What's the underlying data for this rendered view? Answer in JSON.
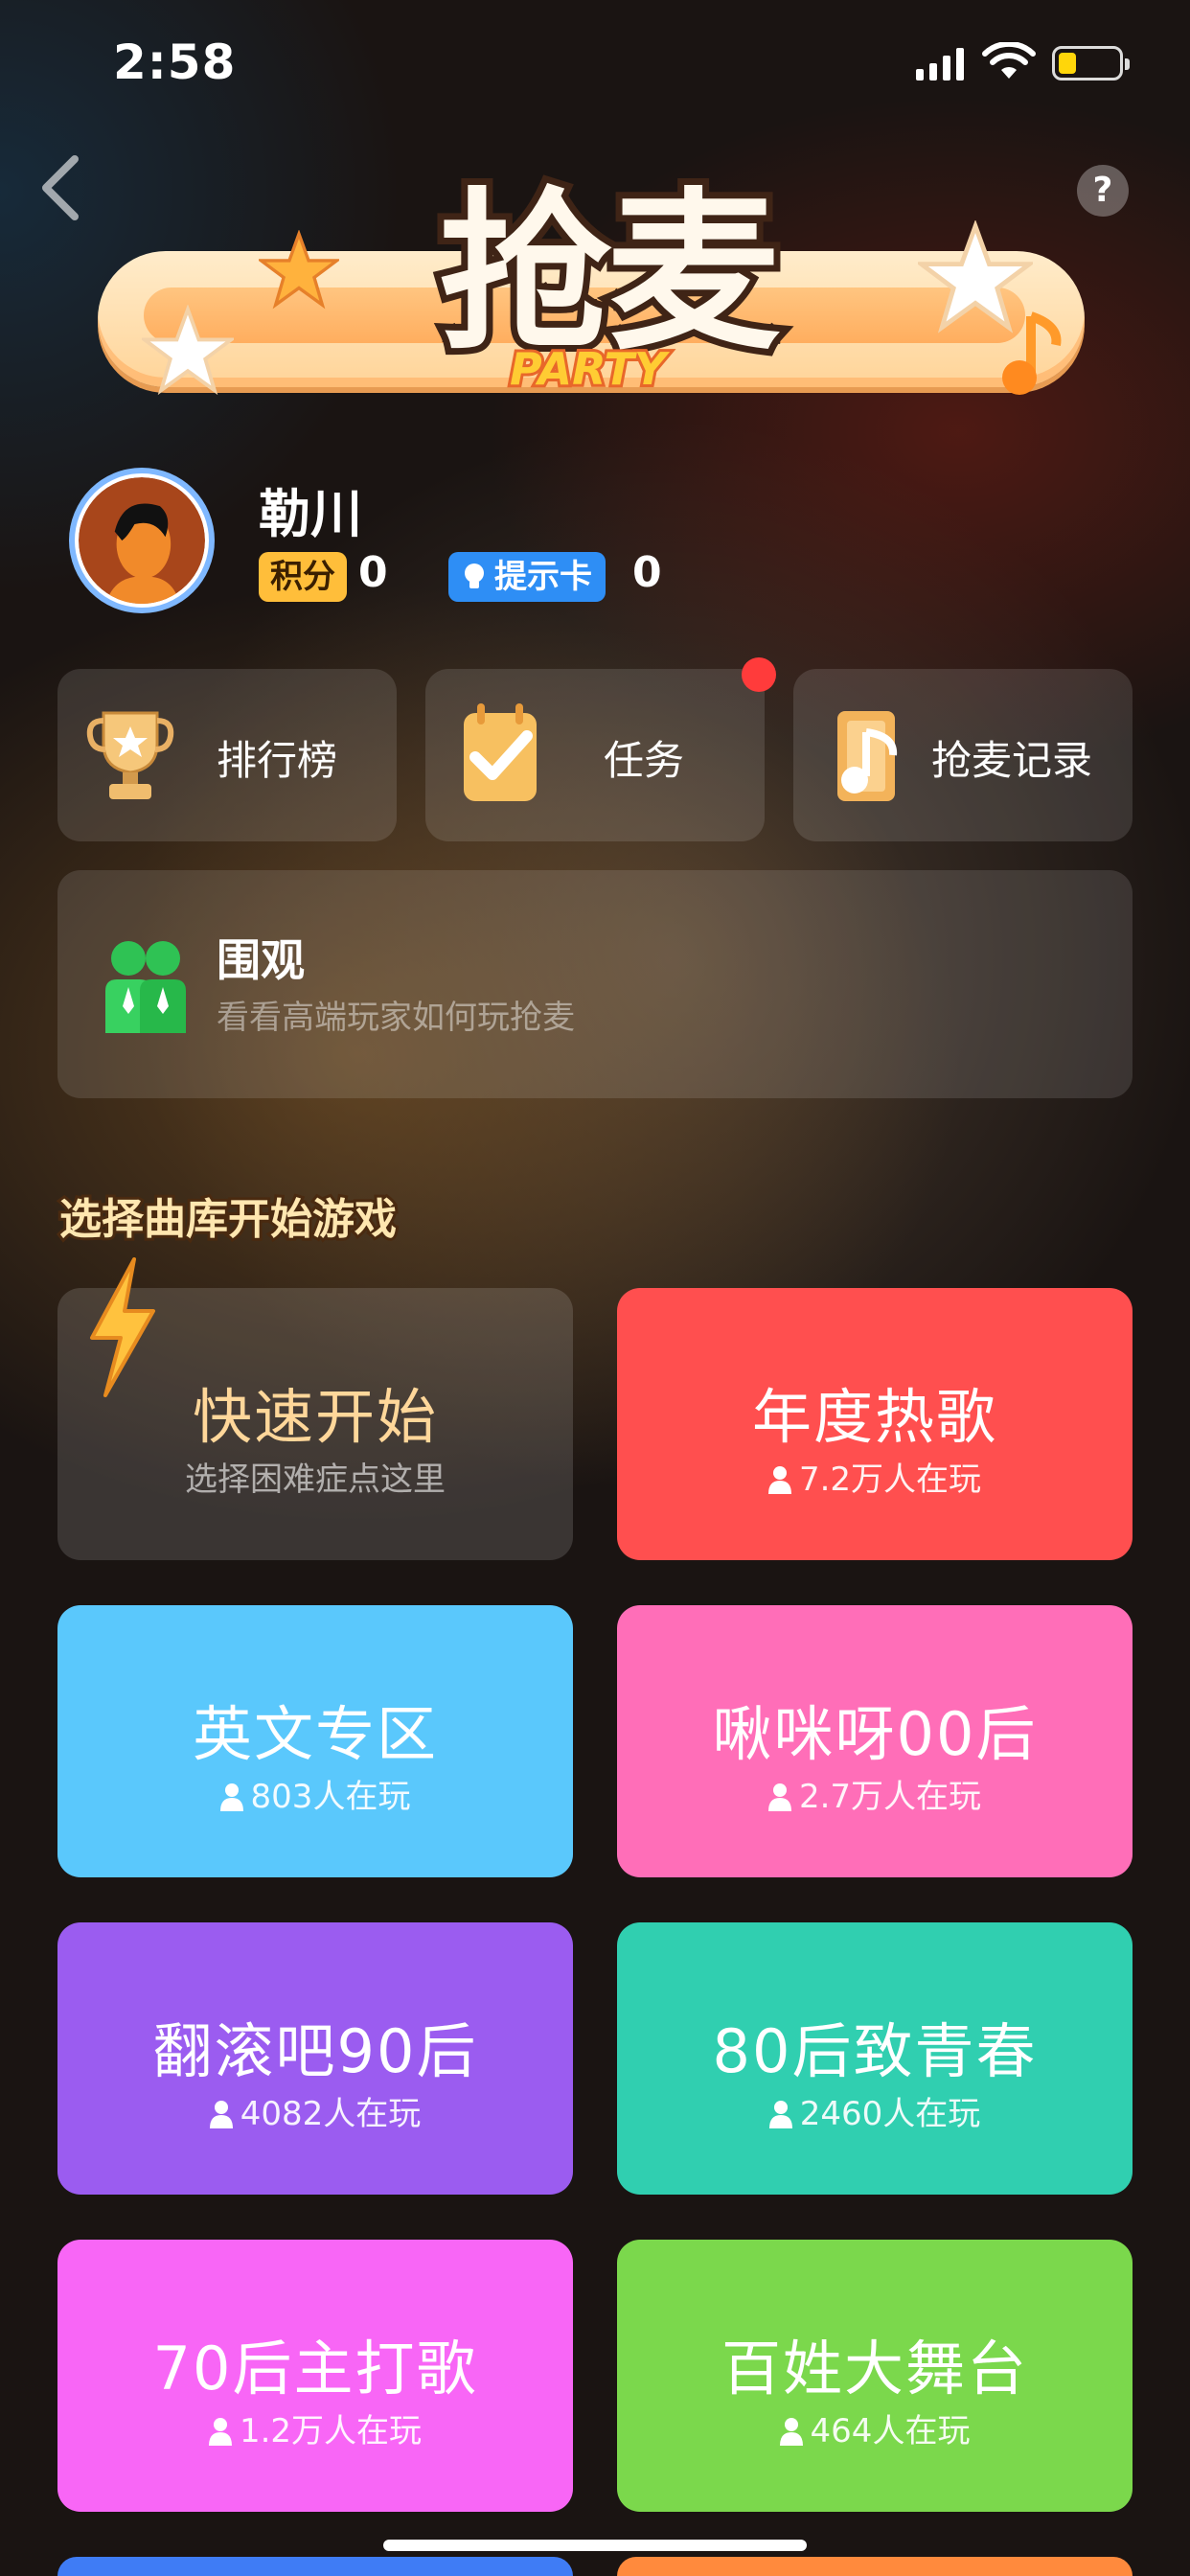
{
  "status_bar": {
    "time": "2:58"
  },
  "header": {
    "help_label": "?"
  },
  "logo": {
    "title": "抢麦",
    "party": "PARTY"
  },
  "profile": {
    "name": "勒川",
    "points_label": "积分",
    "points_value": "0",
    "hint_card_label": "提示卡",
    "hint_card_value": "0"
  },
  "quick_actions": [
    {
      "label": "排行榜",
      "icon": "trophy-icon"
    },
    {
      "label": "任务",
      "icon": "task-icon",
      "has_notification": true
    },
    {
      "label": "抢麦记录",
      "icon": "record-icon"
    }
  ],
  "spectate": {
    "title": "围观",
    "subtitle": "看看高端玩家如何玩抢麦",
    "icon": "people-icon"
  },
  "section_title": "选择曲库开始游戏",
  "song_libraries": [
    {
      "title": "快速开始",
      "subtitle": "选择困难症点这里",
      "color": "#4b423c"
    },
    {
      "title": "年度热歌",
      "players": "7.2万人在玩",
      "color": "#ff4f4f"
    },
    {
      "title": "英文专区",
      "players": "803人在玩",
      "color": "#5ac8fc"
    },
    {
      "title": "啾咪呀00后",
      "players": "2.7万人在玩",
      "color": "#ff6eb8"
    },
    {
      "title": "翻滚吧90后",
      "players": "4082人在玩",
      "color": "#9b5cf0"
    },
    {
      "title": "80后致青春",
      "players": "2460人在玩",
      "color": "#30cfb0"
    },
    {
      "title": "70后主打歌",
      "players": "1.2万人在玩",
      "color": "#f866f6"
    },
    {
      "title": "百姓大舞台",
      "players": "464人在玩",
      "color": "#7bd84c"
    }
  ],
  "colors": {
    "accent": "#ffbe3a",
    "hint_badge": "#2e8ef5",
    "notification": "#ff3b3b"
  }
}
